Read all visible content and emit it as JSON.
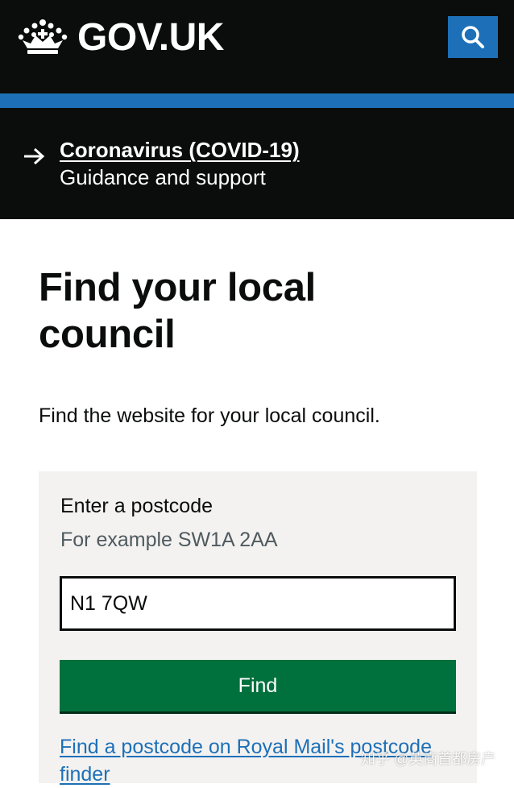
{
  "header": {
    "logo_text": "GOV.UK",
    "search_icon": "search-icon",
    "logo_icon": "crown-icon"
  },
  "covid_banner": {
    "icon": "arrow-right-icon",
    "link_text": "Coronavirus (COVID-19)",
    "subtext": "Guidance and support"
  },
  "main": {
    "title": "Find your local council",
    "lead": "Find the website for your local council."
  },
  "form": {
    "label": "Enter a postcode",
    "hint": "For example SW1A 2AA",
    "postcode_value": "N1 7QW",
    "button_label": "Find",
    "royal_mail_link": "Find a postcode on Royal Mail's postcode finder"
  },
  "watermark": {
    "text": "知乎 @英商首都房产"
  },
  "colors": {
    "header_bg": "#0b0c0c",
    "brand_blue": "#1d70b8",
    "button_green": "#00703c",
    "panel_grey": "#f3f2f1",
    "hint_grey": "#505a5f"
  }
}
